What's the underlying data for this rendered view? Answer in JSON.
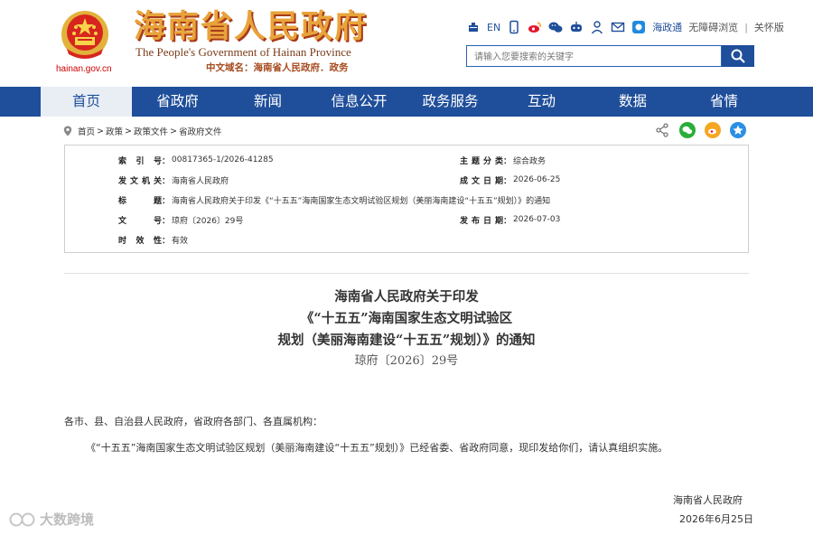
{
  "header": {
    "title_cn": "海南省人民政府",
    "title_en": "The People's Government of Hainan Province",
    "domain_cn": "中文域名：海南省人民政府．政务",
    "site_domain": "hainan.gov.cn",
    "toolbar": {
      "en_label": "EN",
      "app_label": "海政通",
      "accessibility_label": "无障碍浏览",
      "separator": "|",
      "elder_label": "关怀版"
    },
    "search": {
      "placeholder": "请输入您要搜索的关键字"
    }
  },
  "nav": {
    "items": [
      {
        "label": "首页",
        "active": true
      },
      {
        "label": "省政府"
      },
      {
        "label": "新闻"
      },
      {
        "label": "信息公开"
      },
      {
        "label": "政务服务"
      },
      {
        "label": "互动"
      },
      {
        "label": "数据"
      },
      {
        "label": "省情"
      }
    ]
  },
  "breadcrumb": {
    "items": [
      "首页",
      "政策",
      "政策文件",
      "省政府文件"
    ],
    "separator": ">"
  },
  "meta": {
    "index_label": "索 引 号",
    "index_value": "00817365-1/2026-41285",
    "category_label": "主题分类",
    "category_value": "综合政务",
    "issuer_label": "发文机关",
    "issuer_value": "海南省人民政府",
    "created_label": "成文日期",
    "created_value": "2026-06-25",
    "title_label": "标 题",
    "title_value": "海南省人民政府关于印发《“十五五”海南国家生态文明试验区规划（美丽海南建设“十五五”规划）》的通知",
    "docno_label": "文 号",
    "docno_value": "琼府〔2026〕29号",
    "published_label": "发布日期",
    "published_value": "2026-07-03",
    "validity_label": "时 效 性",
    "validity_value": "有效"
  },
  "document": {
    "title_lines": [
      "海南省人民政府关于印发",
      "《“十五五”海南国家生态文明试验区",
      "规划（美丽海南建设“十五五”规划）》的通知"
    ],
    "number": "琼府〔2026〕29号",
    "salutation": "各市、县、自治县人民政府，省政府各部门、各直属机构：",
    "body": "《“十五五”海南国家生态文明试验区规划（美丽海南建设“十五五”规划）》已经省委、省政府同意，现印发给你们，请认真组织实施。",
    "signature_org": "海南省人民政府",
    "signature_date": "2026年6月25日"
  },
  "watermark": {
    "text": "大数跨境"
  },
  "colors": {
    "brand_blue": "#1f4e9a",
    "emblem_red": "#d7261e",
    "logo_gold": "#e8a33a"
  }
}
